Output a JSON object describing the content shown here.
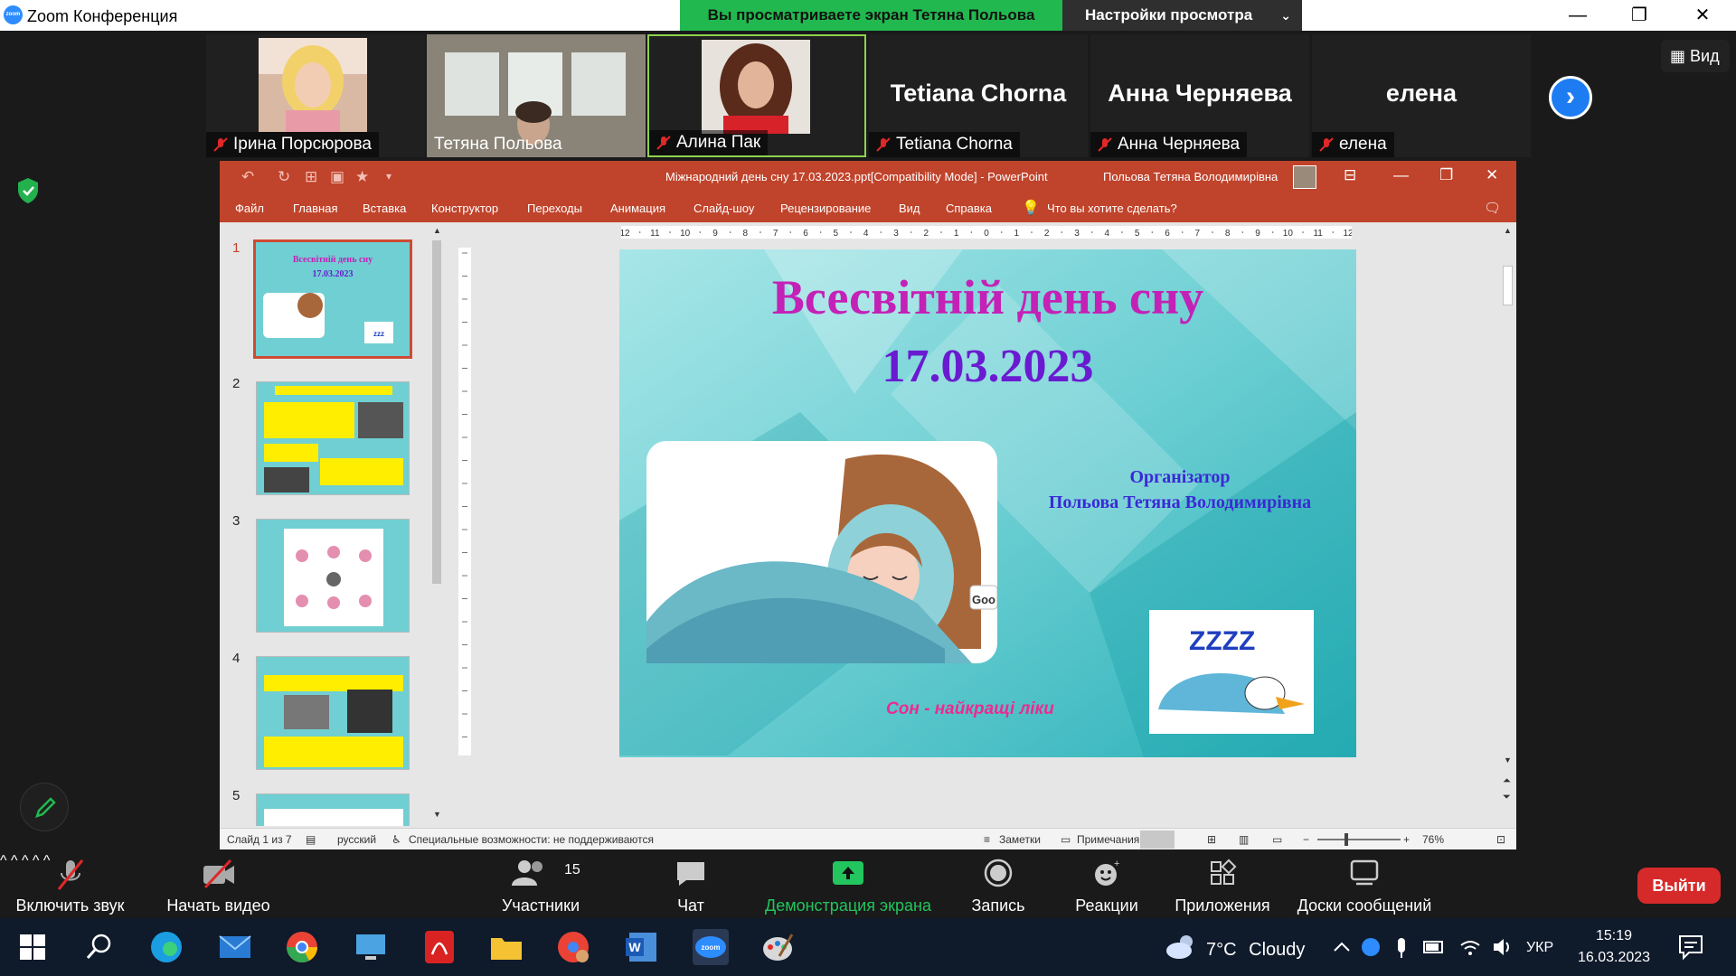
{
  "window": {
    "app_title": "Zoom Конференция",
    "share_banner": "Вы просматриваете экран Тетяна Польова",
    "view_options": "Настройки просмотра",
    "view_button": "Вид"
  },
  "participants": [
    {
      "name": "Ірина Порсюрова",
      "has_video": true
    },
    {
      "name": "Тетяна Польова",
      "has_video": true
    },
    {
      "name": "Алина Пак",
      "has_video": true,
      "active_speaker": true
    },
    {
      "name": "Tetiana Chorna",
      "has_video": false
    },
    {
      "name": "Анна Черняева",
      "has_video": false
    },
    {
      "name": "елена",
      "has_video": false
    }
  ],
  "powerpoint": {
    "document_title": "Міжнародний день сну 17.03.2023.ppt[Compatibility Mode]  -  PowerPoint",
    "user_name": "Польова Тетяна Володимирівна",
    "ribbon_tabs": [
      "Файл",
      "Главная",
      "Вставка",
      "Конструктор",
      "Переходы",
      "Анимация",
      "Слайд-шоу",
      "Рецензирование",
      "Вид",
      "Справка"
    ],
    "tell_me": "Что вы хотите сделать?",
    "thumbnails": [
      "1",
      "2",
      "3",
      "4",
      "5"
    ],
    "slide": {
      "title": "Всесвітній день сну",
      "date": "17.03.2023",
      "organizer_label": "Організатор",
      "organizer_name": "Польова Тетяна Володимирівна",
      "slogan": "Сон - найкращі ліки",
      "goodnight_text": "Goo",
      "zzz": "ZZZZ"
    },
    "ruler_ticks": [
      "12",
      "11",
      "10",
      "9",
      "8",
      "7",
      "6",
      "5",
      "4",
      "3",
      "2",
      "1",
      "0",
      "1",
      "2",
      "3",
      "4",
      "5",
      "6",
      "7",
      "8",
      "9",
      "10",
      "11",
      "12"
    ],
    "status": {
      "slide_of": "Слайд 1 из 7",
      "language": "русский",
      "accessibility": "Специальные возможности: не поддерживаются",
      "notes": "Заметки",
      "comments": "Примечания",
      "zoom": "76%"
    }
  },
  "toolbar": {
    "unmute": "Включить звук",
    "start_video": "Начать видео",
    "participants": "Участники",
    "participants_count": "15",
    "chat": "Чат",
    "share_screen": "Демонстрация экрана",
    "record": "Запись",
    "reactions": "Реакции",
    "apps": "Приложения",
    "whiteboards": "Доски сообщений",
    "leave": "Выйти"
  },
  "taskbar": {
    "weather_temp": "7°C",
    "weather_desc": "Cloudy",
    "language": "УКР",
    "time": "15:19",
    "date": "16.03.2023"
  },
  "colors": {
    "share_green": "#21b94f",
    "ppt_red": "#c0432b",
    "zoom_blue": "#2d8cff",
    "leave_red": "#d62a2a"
  }
}
